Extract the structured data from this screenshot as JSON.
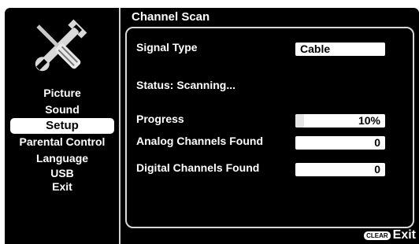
{
  "sidebar": {
    "icon": "wrench-screwdriver-icon",
    "items": [
      {
        "label": "Picture",
        "selected": false
      },
      {
        "label": "Sound",
        "selected": false
      },
      {
        "label": "Setup",
        "selected": true
      },
      {
        "label": "Parental Control",
        "selected": false
      },
      {
        "label": "Language",
        "selected": false
      },
      {
        "label": "USB",
        "selected": false
      },
      {
        "label": "Exit",
        "selected": false
      }
    ]
  },
  "panel": {
    "title": "Channel Scan",
    "signal_type": {
      "label": "Signal Type",
      "value": "Cable"
    },
    "status": "Status: Scanning...",
    "progress": {
      "label": "Progress",
      "value": "10%",
      "fraction": 0.1
    },
    "analog": {
      "label": "Analog Channels Found",
      "value": "0"
    },
    "digital": {
      "label": "Digital Channels Found",
      "value": "0"
    }
  },
  "footer": {
    "clear_label": "CLEAR",
    "exit_label": "Exit"
  },
  "colors": {
    "background": "#000000",
    "highlight": "#ffffff",
    "frame": "#d8d8d8"
  }
}
